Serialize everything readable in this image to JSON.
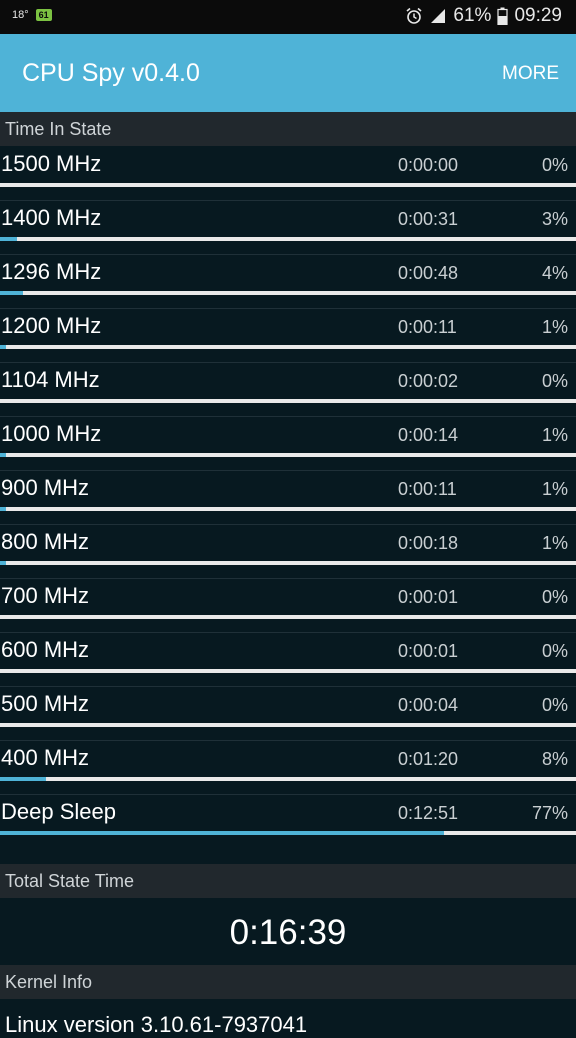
{
  "status_bar": {
    "temp": "18°",
    "badge": "61",
    "battery_percent": "61%",
    "time": "09:29",
    "icons": [
      "alarm-icon",
      "signal-icon",
      "battery-icon"
    ]
  },
  "app_bar": {
    "title": "CPU Spy v0.4.0",
    "more_label": "MORE",
    "accent_color": "#4fb3d7"
  },
  "sections": {
    "time_in_state": "Time In State",
    "total_state_time": "Total State Time",
    "kernel_info": "Kernel Info"
  },
  "states": [
    {
      "freq": "1500 MHz",
      "time": "0:00:00",
      "percent": "0%",
      "share": 0.0
    },
    {
      "freq": "1400 MHz",
      "time": "0:00:31",
      "percent": "3%",
      "share": 0.03
    },
    {
      "freq": "1296 MHz",
      "time": "0:00:48",
      "percent": "4%",
      "share": 0.04
    },
    {
      "freq": "1200 MHz",
      "time": "0:00:11",
      "percent": "1%",
      "share": 0.01
    },
    {
      "freq": "1104 MHz",
      "time": "0:00:02",
      "percent": "0%",
      "share": 0.0
    },
    {
      "freq": "1000 MHz",
      "time": "0:00:14",
      "percent": "1%",
      "share": 0.01
    },
    {
      "freq": "900 MHz",
      "time": "0:00:11",
      "percent": "1%",
      "share": 0.01
    },
    {
      "freq": "800 MHz",
      "time": "0:00:18",
      "percent": "1%",
      "share": 0.01
    },
    {
      "freq": "700 MHz",
      "time": "0:00:01",
      "percent": "0%",
      "share": 0.0
    },
    {
      "freq": "600 MHz",
      "time": "0:00:01",
      "percent": "0%",
      "share": 0.0
    },
    {
      "freq": "500 MHz",
      "time": "0:00:04",
      "percent": "0%",
      "share": 0.0
    },
    {
      "freq": "400 MHz",
      "time": "0:01:20",
      "percent": "8%",
      "share": 0.08
    },
    {
      "freq": "Deep Sleep",
      "time": "0:12:51",
      "percent": "77%",
      "share": 0.77
    }
  ],
  "total_state_time": "0:16:39",
  "kernel_info_text": "Linux version 3.10.61-7937041"
}
